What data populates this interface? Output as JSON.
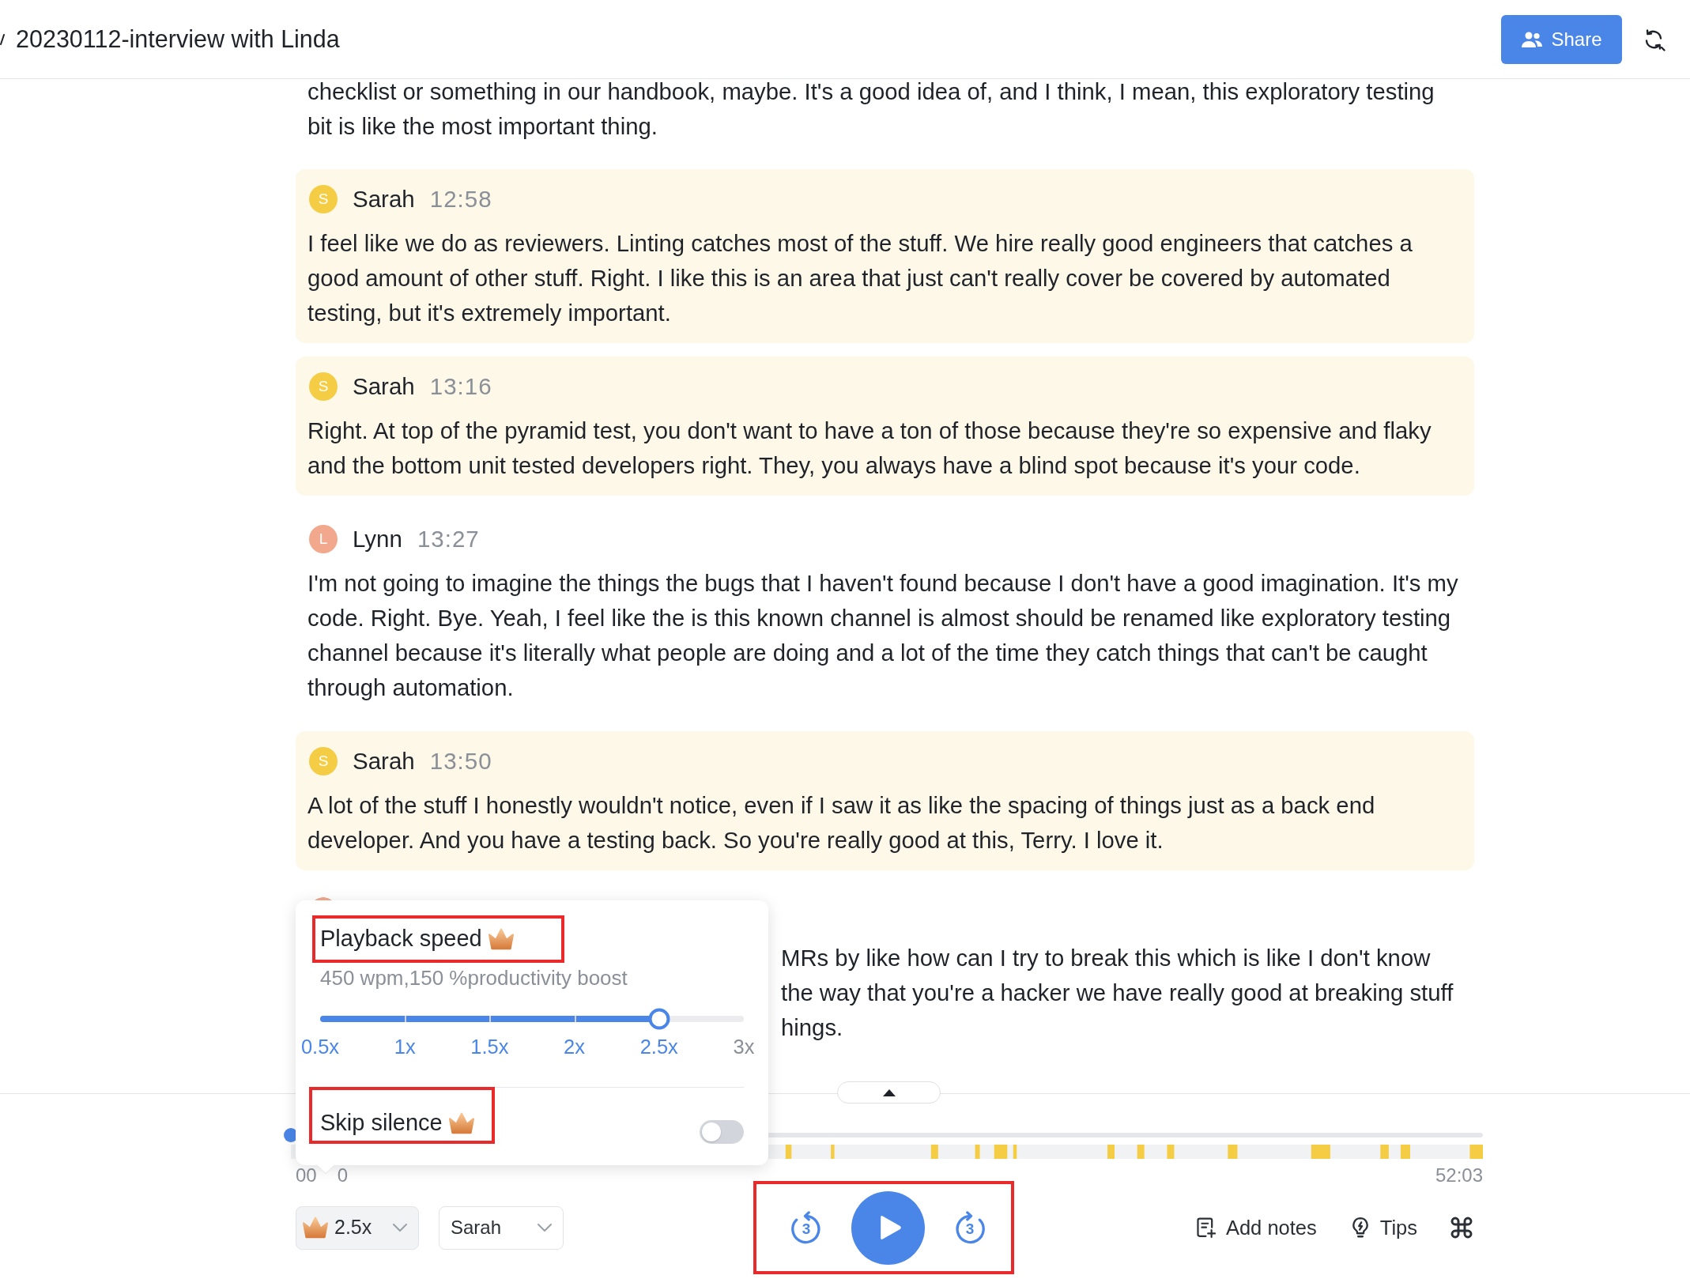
{
  "header": {
    "title": "20230112-interview with Linda",
    "share_button": "Share"
  },
  "transcript": {
    "continued_text": "checklist or something in our handbook, maybe. It's a good idea of, and I think, I mean, this exploratory testing bit is like the most important thing.",
    "messages": [
      {
        "speaker": "Sarah",
        "initial": "S",
        "color": "#f5cd45",
        "time": "12:58",
        "highlighted": true,
        "text": "I feel like we do as reviewers. Linting catches most of the stuff. We hire really good engineers that catches a good amount of other stuff. Right. I like this is an area that just can't really cover be covered by automated testing, but it's extremely important."
      },
      {
        "speaker": "Sarah",
        "initial": "S",
        "color": "#f5cd45",
        "time": "13:16",
        "highlighted": true,
        "text": "Right. At top of the pyramid test, you don't want to have a ton of those because they're so expensive and flaky and the bottom unit tested developers right. They, you always have a blind spot because it's your code."
      },
      {
        "speaker": "Lynn",
        "initial": "L",
        "color": "#f2a88c",
        "time": "13:27",
        "highlighted": false,
        "text": "I'm not going to imagine the things the bugs that I haven't found because I don't have a good imagination. It's my code. Right. Bye. Yeah, I feel like the is this known channel is almost should be renamed like exploratory testing channel because it's literally what people are doing and a lot of the time they catch things that can't be caught through automation."
      },
      {
        "speaker": "Sarah",
        "initial": "S",
        "color": "#f5cd45",
        "time": "13:50",
        "highlighted": true,
        "text": "A lot of the stuff I honestly wouldn't notice, even if I saw it as like the spacing of things just as a back end developer. And you have a testing back. So you're really good at this, Terry. I love it."
      }
    ],
    "partial_message": {
      "color": "#f2a88c",
      "visible_lines": [
        "MRs by like how can I try to break this which is like I don't know",
        "the way that you're a hacker we have really good at breaking stuff",
        "hings."
      ]
    }
  },
  "speed_popup": {
    "title": "Playback speed",
    "premium": true,
    "highlighted": true,
    "subtitle": "450 wpm,150 %productivity boost",
    "level": 0.8,
    "marks": [
      {
        "label": "0.5x",
        "reached": true
      },
      {
        "label": "1x",
        "reached": true
      },
      {
        "label": "1.5x",
        "reached": true
      },
      {
        "label": "2x",
        "reached": true
      },
      {
        "label": "2.5x",
        "reached": true
      },
      {
        "label": "3x",
        "reached": false
      }
    ],
    "skip_silence": {
      "label": "Skip silence",
      "premium": true,
      "highlighted": true,
      "on": false
    }
  },
  "player": {
    "level": 0,
    "elapsed_time_visible": [
      "00",
      "0"
    ],
    "duration": "52:03",
    "speed_button": {
      "label": "2.5x",
      "premium": true
    },
    "speaker_filter": "Sarah",
    "controls": {
      "highlighted": true,
      "rewind": "3",
      "forward": "3",
      "playing": false
    },
    "actions": [
      {
        "kind": "notes",
        "label": "Add notes"
      },
      {
        "kind": "tips",
        "label": "Tips"
      },
      {
        "kind": "shortcuts"
      }
    ]
  }
}
